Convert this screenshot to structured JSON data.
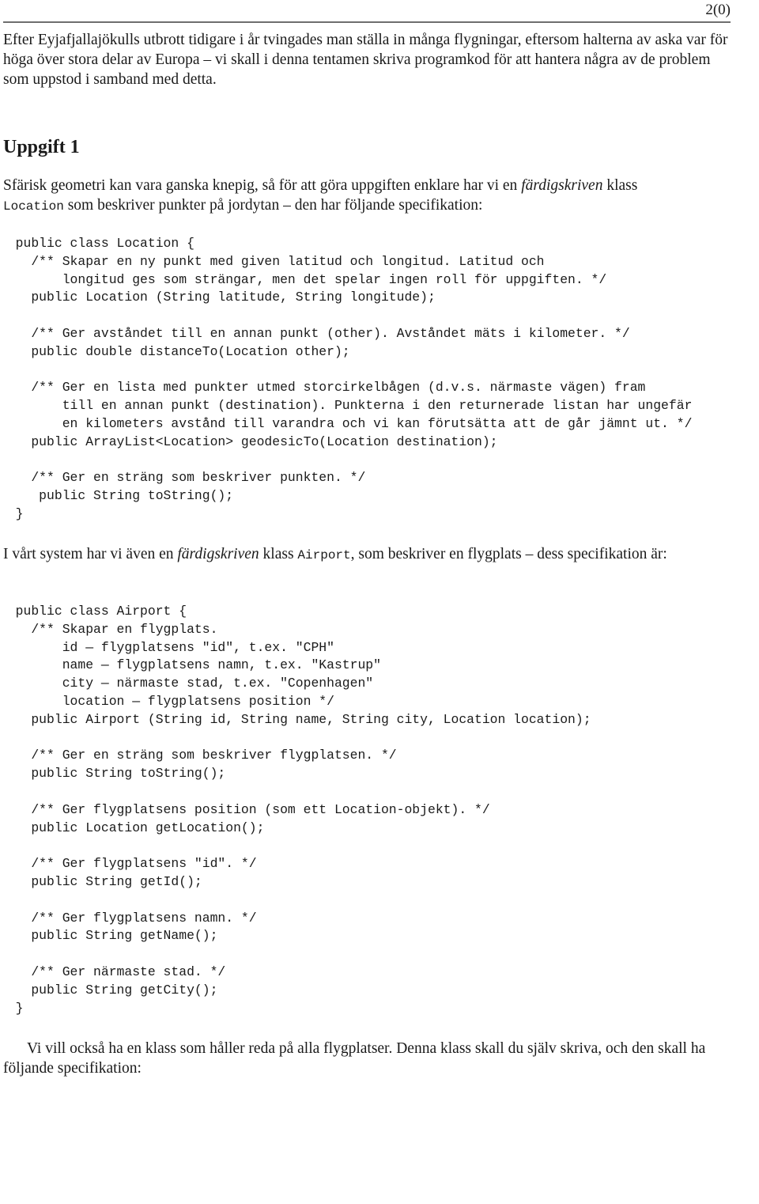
{
  "header": {
    "page_number": "2(0)"
  },
  "intro": {
    "text": "Efter Eyjafjallajökulls utbrott tidigare i år tvingades man ställa in många flygningar, eftersom halterna av aska var för höga över stora delar av Europa – vi skall i denna tentamen skriva programkod för att hantera några av de problem som uppstod i samband med detta."
  },
  "task": {
    "heading": "Uppgift 1",
    "para1": {
      "before_italic": "Sfärisk geometri kan vara ganska knepig, så för att göra uppgiften enklare har vi en ",
      "italic": "färdigskriven",
      "after_italic": " klass ",
      "code": "Location",
      "rest": " som beskriver punkter på jordytan – den har följande specifikation:"
    },
    "location_code": [
      "  public class Location {",
      "    /** Skapar en ny punkt med given latitud och longitud. Latitud och",
      "        longitud ges som strängar, men det spelar ingen roll för uppgiften. */",
      "    public Location (String latitude, String longitude);",
      "",
      "    /** Ger avståndet till en annan punkt (other). Avståndet mäts i kilometer. */",
      "    public double distanceTo(Location other);",
      "",
      "    /** Ger en lista med punkter utmed storcirkelbågen (d.v.s. närmaste vägen) fram",
      "        till en annan punkt (destination). Punkterna i den returnerade listan har ungefär",
      "        en kilometers avstånd till varandra och vi kan förutsätta att de går jämnt ut. */",
      "    public ArrayList<Location> geodesicTo(Location destination);",
      "",
      "    /** Ger en sträng som beskriver punkten. */",
      "     public String toString();",
      "  }"
    ],
    "para2": {
      "before_italic": "I vårt system har vi även en ",
      "italic": "färdigskriven",
      "after_italic": " klass ",
      "code": "Airport",
      "rest": ", som beskriver en flygplats – dess specifikation är:"
    },
    "airport_code": [
      "  public class Airport {",
      "    /** Skapar en flygplats.",
      "        id — flygplatsens \"id\", t.ex. \"CPH\"",
      "        name — flygplatsens namn, t.ex. \"Kastrup\"",
      "        city — närmaste stad, t.ex. \"Copenhagen\"",
      "        location — flygplatsens position */",
      "    public Airport (String id, String name, String city, Location location);",
      "",
      "    /** Ger en sträng som beskriver flygplatsen. */",
      "    public String toString();",
      "",
      "    /** Ger flygplatsens position (som ett Location-objekt). */",
      "    public Location getLocation();",
      "",
      "    /** Ger flygplatsens \"id\". */",
      "    public String getId();",
      "",
      "    /** Ger flygplatsens namn. */",
      "    public String getName();",
      "",
      "    /** Ger närmaste stad. */",
      "    public String getCity();",
      "  }"
    ],
    "para3": "Vi vill också ha en klass som håller reda på alla flygplatser. Denna klass skall du själv skriva, och den skall ha följande specifikation:"
  }
}
